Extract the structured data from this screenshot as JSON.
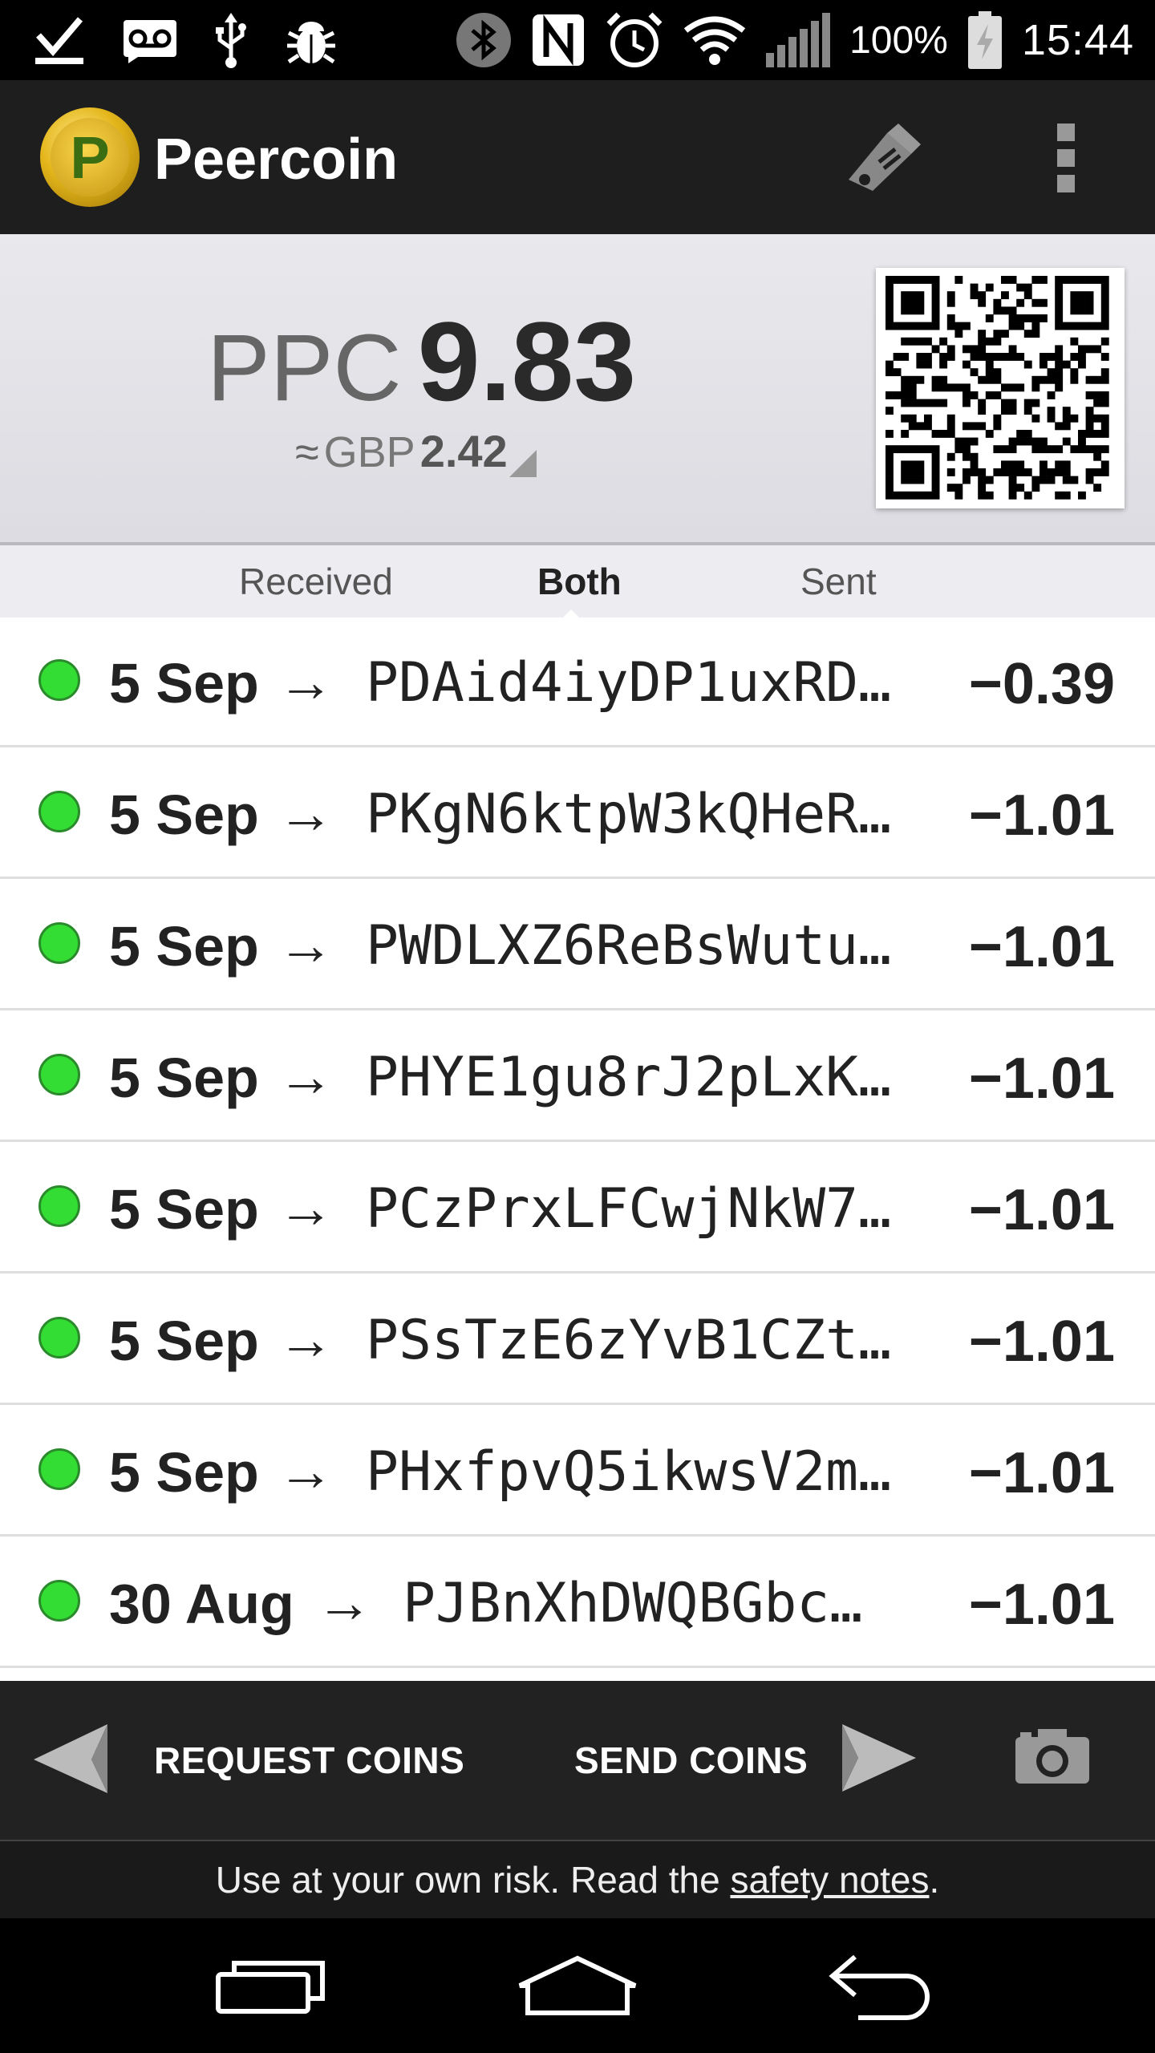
{
  "status_bar": {
    "battery": "100%",
    "time": "15:44"
  },
  "app_bar": {
    "title": "Peercoin",
    "logo_letter": "P"
  },
  "balance": {
    "currency": "PPC",
    "amount": "9.83",
    "approx_symbol": "≈",
    "fiat_currency": "GBP",
    "fiat_amount": "2.42"
  },
  "tabs": [
    {
      "label": "Received"
    },
    {
      "label": "Both",
      "active": true
    },
    {
      "label": "Sent"
    }
  ],
  "transactions": [
    {
      "date": "5 Sep",
      "address": "PDAid4iyDP1uxRD…",
      "amount": "−0.39"
    },
    {
      "date": "5 Sep",
      "address": "PKgN6ktpW3kQHeR…",
      "amount": "−1.01"
    },
    {
      "date": "5 Sep",
      "address": "PWDLXZ6ReBsWutu…",
      "amount": "−1.01"
    },
    {
      "date": "5 Sep",
      "address": "PHYE1gu8rJ2pLxK…",
      "amount": "−1.01"
    },
    {
      "date": "5 Sep",
      "address": "PCzPrxLFCwjNkW7…",
      "amount": "−1.01"
    },
    {
      "date": "5 Sep",
      "address": "PSsTzE6zYvB1CZt…",
      "amount": "−1.01"
    },
    {
      "date": "5 Sep",
      "address": "PHxfpvQ5ikwsV2m…",
      "amount": "−1.01"
    },
    {
      "date": "30 Aug",
      "address": "PJBnXhDWQBGbc…",
      "amount": "−1.01"
    }
  ],
  "arrow_glyph": "→",
  "actions": {
    "request_label": "REQUEST COINS",
    "send_label": "SEND COINS"
  },
  "footer": {
    "prefix": "Use at your own risk. Read the ",
    "link": "safety notes",
    "suffix": "."
  },
  "colors": {
    "status_dot": "#33dd33",
    "app_bar": "#1e1e1e",
    "balance_bg": "#e5e5ea"
  }
}
